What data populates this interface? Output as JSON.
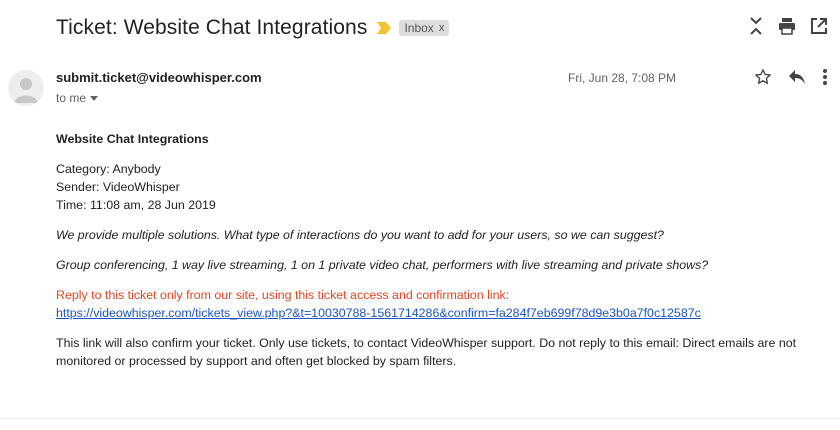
{
  "header": {
    "subject": "Ticket: Website Chat Integrations",
    "label_chip": "Inbox",
    "label_chip_close": "x",
    "icons": [
      "importance-marker-icon",
      "expand-all-icon",
      "print-icon",
      "open-in-new-window-icon"
    ]
  },
  "message": {
    "sender": "submit.ticket@videowhisper.com",
    "recipient": "to me",
    "date": "Fri, Jun 28, 7:08 PM",
    "actions": [
      "star-icon",
      "reply-icon",
      "more-vert-icon"
    ]
  },
  "body": {
    "title": "Website Chat Integrations",
    "category": "Category: Anybody",
    "sender_line": "Sender: VideoWhisper",
    "time": "Time: 11:08 am, 28 Jun 2019",
    "question": "We provide multiple solutions. What type of interactions do you want to add for your users, so we can suggest?",
    "options": "Group conferencing, 1 way live streaming, 1 on 1 private video chat, performers with live streaming and private shows?",
    "reply_notice": "Reply to this ticket only from our site, using this ticket access and confirmation link:",
    "ticket_link": "https://videowhisper.com/tickets_view.php?&t=10030788-1561714286&confirm=fa284f7eb699f78d9e3b0a7f0c12587c",
    "footer": "This link will also confirm your ticket. Only use tickets, to contact VideoWhisper support. Do not reply to this email: Direct emails are not monitored or processed by support and often get blocked by spam filters."
  },
  "colors": {
    "notice_red": "#e8451c",
    "link_blue": "#1a55c8",
    "importance_yellow": "#f4c430"
  }
}
